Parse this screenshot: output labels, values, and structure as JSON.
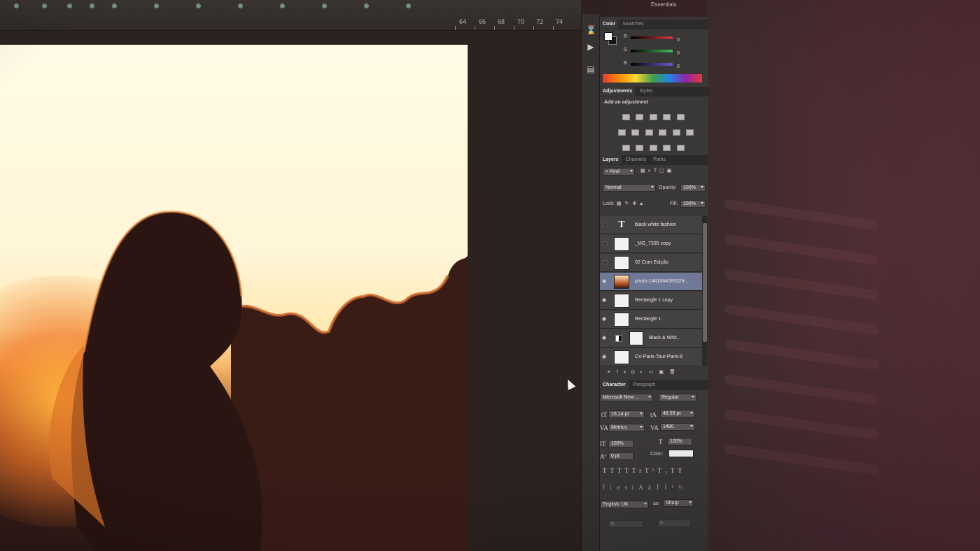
{
  "app": {
    "workspace_label": "Essentials"
  },
  "ruler": {
    "labels": [
      "64",
      "66",
      "68",
      "70",
      "72",
      "74"
    ]
  },
  "color_panel": {
    "tabs": [
      "Color",
      "Swatches"
    ],
    "channels": [
      {
        "label": "R",
        "value": "0",
        "color": "#d23a3a"
      },
      {
        "label": "G",
        "value": "0",
        "color": "#3fbf5a"
      },
      {
        "label": "B",
        "value": "0",
        "color": "#6b5bd6"
      }
    ]
  },
  "adjustments_panel": {
    "tabs": [
      "Adjustments",
      "Styles"
    ],
    "heading": "Add an adjustment"
  },
  "layers_panel": {
    "tabs": [
      "Layers",
      "Channels",
      "Paths"
    ],
    "filter_kind": "Kind",
    "blend_mode": "Normal",
    "opacity_label": "Opacity:",
    "opacity_value": "100%",
    "lock_label": "Lock:",
    "fill_label": "Fill:",
    "fill_value": "100%",
    "layers": [
      {
        "name": "black white fashion",
        "type": "text",
        "visible": false,
        "selected": false
      },
      {
        "name": "_MG_7335 copy",
        "type": "image",
        "visible": false,
        "selected": false
      },
      {
        "name": "02 Com Edição",
        "type": "image",
        "visible": false,
        "selected": false
      },
      {
        "name": "photo-1441884069328-...",
        "type": "photo",
        "visible": true,
        "selected": true
      },
      {
        "name": "Rectangle 1 copy",
        "type": "shape",
        "visible": true,
        "selected": false
      },
      {
        "name": "Rectangle 1",
        "type": "shape",
        "visible": true,
        "selected": false
      },
      {
        "name": "Black & Whit...",
        "type": "adjustment",
        "visible": true,
        "selected": false
      },
      {
        "name": "CV-Paris-Tour-Paris-8",
        "type": "image",
        "visible": true,
        "selected": false
      }
    ]
  },
  "character_panel": {
    "tabs": [
      "Character",
      "Paragraph"
    ],
    "font_family": "Microsoft New ...",
    "font_style": "Regular",
    "font_size": "15,14 pt",
    "leading": "46,59 pt",
    "kerning": "Metrics",
    "tracking": "1480",
    "vertical_scale": "100%",
    "horizontal_scale": "100%",
    "baseline_shift": "0 pt",
    "color_label": "Color:",
    "language": "English: UK",
    "antialias_label": "aɑ",
    "antialias": "Sharp",
    "extra_value_1": "0",
    "extra_value_2": "0"
  }
}
